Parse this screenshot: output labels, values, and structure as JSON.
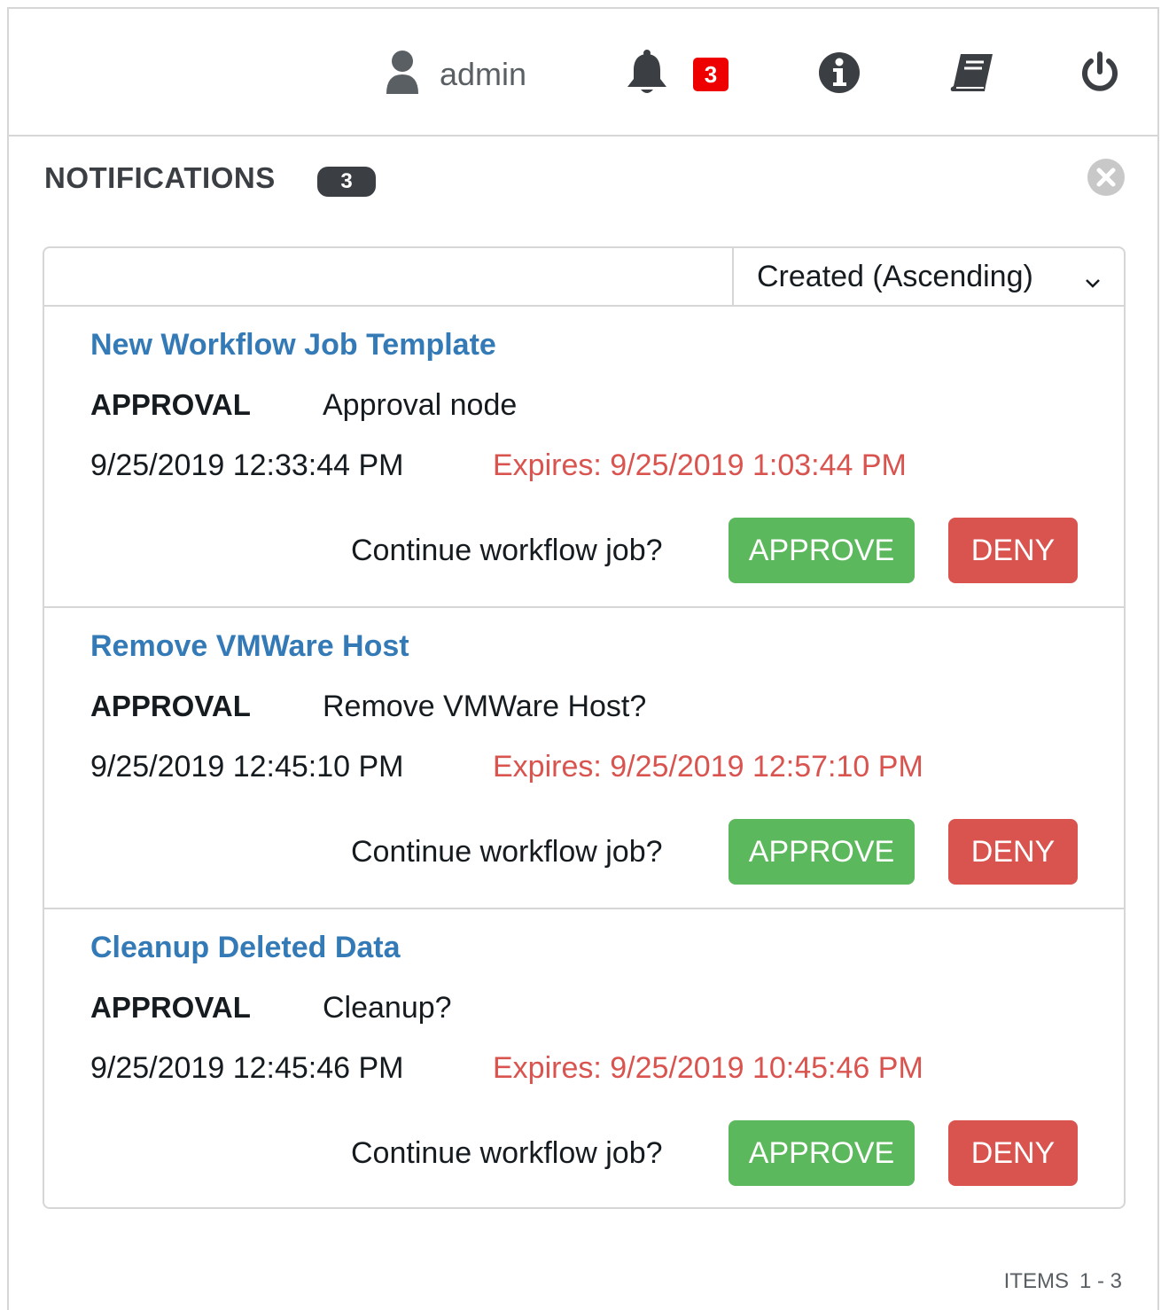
{
  "header": {
    "user": {
      "icon": "user-icon",
      "name": "admin"
    },
    "notifications": {
      "icon": "bell-icon",
      "count": "3",
      "badge_color": "#ee0000"
    },
    "info_icon": "info-icon",
    "docs_icon": "book-icon",
    "logout_icon": "power-icon"
  },
  "panel": {
    "title": "NOTIFICATIONS",
    "count": "3",
    "close_icon": "close-icon"
  },
  "sort": {
    "selected": "Created (Ascending)",
    "icon": "chevron-down-icon"
  },
  "items": [
    {
      "name": "New Workflow Job Template",
      "type": "APPROVAL",
      "description": "Approval node",
      "created": "9/25/2019 12:33:44 PM",
      "expires": "Expires: 9/25/2019 1:03:44 PM",
      "prompt": "Continue workflow job?",
      "approve_label": "APPROVE",
      "deny_label": "DENY"
    },
    {
      "name": "Remove VMWare Host",
      "type": "APPROVAL",
      "description": "Remove VMWare Host?",
      "created": "9/25/2019 12:45:10 PM",
      "expires": "Expires: 9/25/2019 12:57:10 PM",
      "prompt": "Continue workflow job?",
      "approve_label": "APPROVE",
      "deny_label": "DENY"
    },
    {
      "name": "Cleanup Deleted Data",
      "type": "APPROVAL",
      "description": "Cleanup?",
      "created": "9/25/2019 12:45:46 PM",
      "expires": "Expires: 9/25/2019 10:45:46 PM",
      "prompt": "Continue workflow job?",
      "approve_label": "APPROVE",
      "deny_label": "DENY"
    }
  ],
  "footer": {
    "label": "ITEMS",
    "range": "1 - 3"
  },
  "colors": {
    "link": "#337ab7",
    "approve": "#5cb85c",
    "deny": "#d9534f",
    "expires": "#d9534f"
  }
}
